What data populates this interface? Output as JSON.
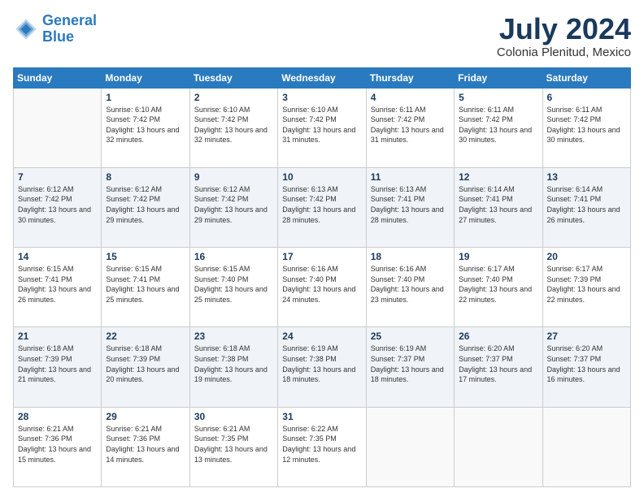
{
  "logo": {
    "line1": "General",
    "line2": "Blue"
  },
  "title": "July 2024",
  "subtitle": "Colonia Plenitud, Mexico",
  "days_of_week": [
    "Sunday",
    "Monday",
    "Tuesday",
    "Wednesday",
    "Thursday",
    "Friday",
    "Saturday"
  ],
  "weeks": [
    [
      {
        "day": "",
        "sunrise": "",
        "sunset": "",
        "daylight": "",
        "empty": true
      },
      {
        "day": "1",
        "sunrise": "Sunrise: 6:10 AM",
        "sunset": "Sunset: 7:42 PM",
        "daylight": "Daylight: 13 hours and 32 minutes."
      },
      {
        "day": "2",
        "sunrise": "Sunrise: 6:10 AM",
        "sunset": "Sunset: 7:42 PM",
        "daylight": "Daylight: 13 hours and 32 minutes."
      },
      {
        "day": "3",
        "sunrise": "Sunrise: 6:10 AM",
        "sunset": "Sunset: 7:42 PM",
        "daylight": "Daylight: 13 hours and 31 minutes."
      },
      {
        "day": "4",
        "sunrise": "Sunrise: 6:11 AM",
        "sunset": "Sunset: 7:42 PM",
        "daylight": "Daylight: 13 hours and 31 minutes."
      },
      {
        "day": "5",
        "sunrise": "Sunrise: 6:11 AM",
        "sunset": "Sunset: 7:42 PM",
        "daylight": "Daylight: 13 hours and 30 minutes."
      },
      {
        "day": "6",
        "sunrise": "Sunrise: 6:11 AM",
        "sunset": "Sunset: 7:42 PM",
        "daylight": "Daylight: 13 hours and 30 minutes."
      }
    ],
    [
      {
        "day": "7",
        "sunrise": "Sunrise: 6:12 AM",
        "sunset": "Sunset: 7:42 PM",
        "daylight": "Daylight: 13 hours and 30 minutes."
      },
      {
        "day": "8",
        "sunrise": "Sunrise: 6:12 AM",
        "sunset": "Sunset: 7:42 PM",
        "daylight": "Daylight: 13 hours and 29 minutes."
      },
      {
        "day": "9",
        "sunrise": "Sunrise: 6:12 AM",
        "sunset": "Sunset: 7:42 PM",
        "daylight": "Daylight: 13 hours and 29 minutes."
      },
      {
        "day": "10",
        "sunrise": "Sunrise: 6:13 AM",
        "sunset": "Sunset: 7:42 PM",
        "daylight": "Daylight: 13 hours and 28 minutes."
      },
      {
        "day": "11",
        "sunrise": "Sunrise: 6:13 AM",
        "sunset": "Sunset: 7:41 PM",
        "daylight": "Daylight: 13 hours and 28 minutes."
      },
      {
        "day": "12",
        "sunrise": "Sunrise: 6:14 AM",
        "sunset": "Sunset: 7:41 PM",
        "daylight": "Daylight: 13 hours and 27 minutes."
      },
      {
        "day": "13",
        "sunrise": "Sunrise: 6:14 AM",
        "sunset": "Sunset: 7:41 PM",
        "daylight": "Daylight: 13 hours and 26 minutes."
      }
    ],
    [
      {
        "day": "14",
        "sunrise": "Sunrise: 6:15 AM",
        "sunset": "Sunset: 7:41 PM",
        "daylight": "Daylight: 13 hours and 26 minutes."
      },
      {
        "day": "15",
        "sunrise": "Sunrise: 6:15 AM",
        "sunset": "Sunset: 7:41 PM",
        "daylight": "Daylight: 13 hours and 25 minutes."
      },
      {
        "day": "16",
        "sunrise": "Sunrise: 6:15 AM",
        "sunset": "Sunset: 7:40 PM",
        "daylight": "Daylight: 13 hours and 25 minutes."
      },
      {
        "day": "17",
        "sunrise": "Sunrise: 6:16 AM",
        "sunset": "Sunset: 7:40 PM",
        "daylight": "Daylight: 13 hours and 24 minutes."
      },
      {
        "day": "18",
        "sunrise": "Sunrise: 6:16 AM",
        "sunset": "Sunset: 7:40 PM",
        "daylight": "Daylight: 13 hours and 23 minutes."
      },
      {
        "day": "19",
        "sunrise": "Sunrise: 6:17 AM",
        "sunset": "Sunset: 7:40 PM",
        "daylight": "Daylight: 13 hours and 22 minutes."
      },
      {
        "day": "20",
        "sunrise": "Sunrise: 6:17 AM",
        "sunset": "Sunset: 7:39 PM",
        "daylight": "Daylight: 13 hours and 22 minutes."
      }
    ],
    [
      {
        "day": "21",
        "sunrise": "Sunrise: 6:18 AM",
        "sunset": "Sunset: 7:39 PM",
        "daylight": "Daylight: 13 hours and 21 minutes."
      },
      {
        "day": "22",
        "sunrise": "Sunrise: 6:18 AM",
        "sunset": "Sunset: 7:39 PM",
        "daylight": "Daylight: 13 hours and 20 minutes."
      },
      {
        "day": "23",
        "sunrise": "Sunrise: 6:18 AM",
        "sunset": "Sunset: 7:38 PM",
        "daylight": "Daylight: 13 hours and 19 minutes."
      },
      {
        "day": "24",
        "sunrise": "Sunrise: 6:19 AM",
        "sunset": "Sunset: 7:38 PM",
        "daylight": "Daylight: 13 hours and 18 minutes."
      },
      {
        "day": "25",
        "sunrise": "Sunrise: 6:19 AM",
        "sunset": "Sunset: 7:37 PM",
        "daylight": "Daylight: 13 hours and 18 minutes."
      },
      {
        "day": "26",
        "sunrise": "Sunrise: 6:20 AM",
        "sunset": "Sunset: 7:37 PM",
        "daylight": "Daylight: 13 hours and 17 minutes."
      },
      {
        "day": "27",
        "sunrise": "Sunrise: 6:20 AM",
        "sunset": "Sunset: 7:37 PM",
        "daylight": "Daylight: 13 hours and 16 minutes."
      }
    ],
    [
      {
        "day": "28",
        "sunrise": "Sunrise: 6:21 AM",
        "sunset": "Sunset: 7:36 PM",
        "daylight": "Daylight: 13 hours and 15 minutes."
      },
      {
        "day": "29",
        "sunrise": "Sunrise: 6:21 AM",
        "sunset": "Sunset: 7:36 PM",
        "daylight": "Daylight: 13 hours and 14 minutes."
      },
      {
        "day": "30",
        "sunrise": "Sunrise: 6:21 AM",
        "sunset": "Sunset: 7:35 PM",
        "daylight": "Daylight: 13 hours and 13 minutes."
      },
      {
        "day": "31",
        "sunrise": "Sunrise: 6:22 AM",
        "sunset": "Sunset: 7:35 PM",
        "daylight": "Daylight: 13 hours and 12 minutes."
      },
      {
        "day": "",
        "sunrise": "",
        "sunset": "",
        "daylight": "",
        "empty": true
      },
      {
        "day": "",
        "sunrise": "",
        "sunset": "",
        "daylight": "",
        "empty": true
      },
      {
        "day": "",
        "sunrise": "",
        "sunset": "",
        "daylight": "",
        "empty": true
      }
    ]
  ]
}
